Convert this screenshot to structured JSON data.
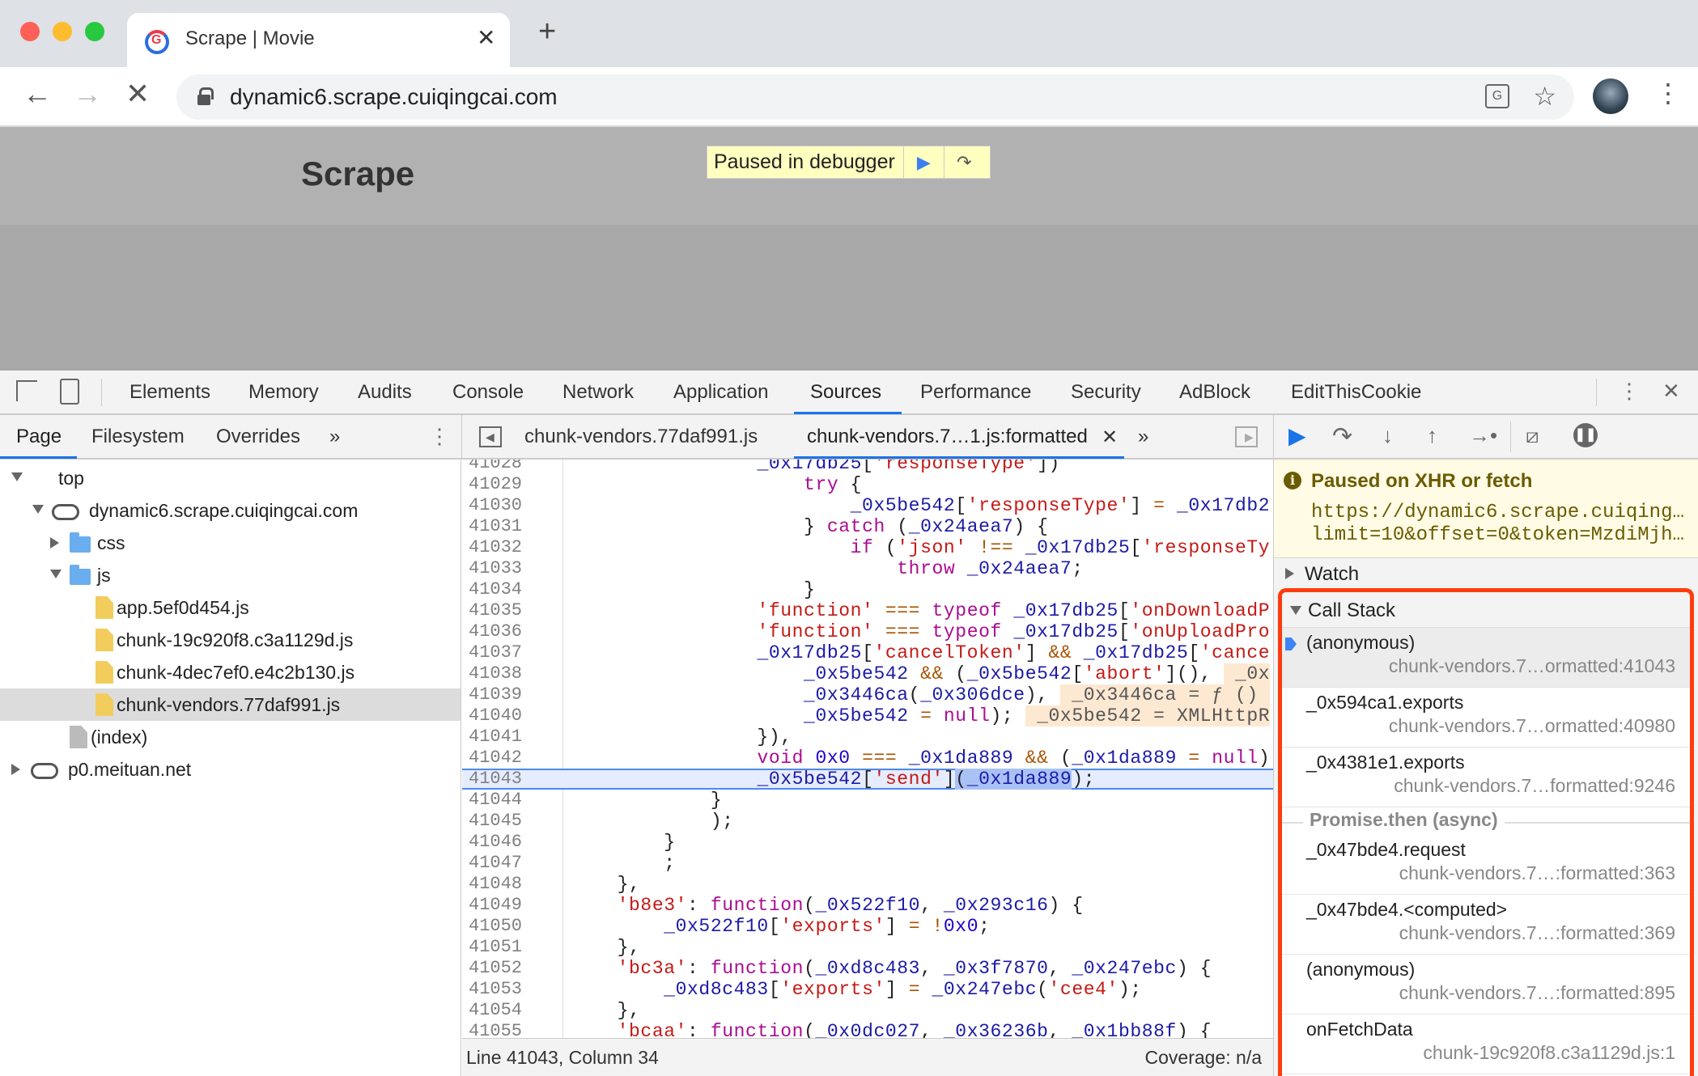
{
  "browser": {
    "tab_title": "Scrape | Movie",
    "url": "dynamic6.scrape.cuiqingcai.com",
    "traffic_colors": {
      "close": "#fe5f57",
      "minimize": "#febc2e",
      "maximize": "#28c840"
    }
  },
  "page": {
    "brand": "Scrape",
    "paused_label": "Paused in debugger"
  },
  "devtools": {
    "tabs": [
      "Elements",
      "Memory",
      "Audits",
      "Console",
      "Network",
      "Application",
      "Sources",
      "Performance",
      "Security",
      "AdBlock",
      "EditThisCookie"
    ],
    "active_tab": "Sources",
    "accent": "#1a73e8",
    "navigator_tabs": [
      "Page",
      "Filesystem",
      "Overrides"
    ],
    "more_label": "»",
    "editor_tabs": [
      {
        "label": "chunk-vendors.77daf991.js",
        "active": false
      },
      {
        "label": "chunk-vendors.7…1.js:formatted",
        "active": true
      }
    ],
    "tree": [
      {
        "label": "top",
        "level": 0,
        "icon": "window",
        "arrow": "down"
      },
      {
        "label": "dynamic6.scrape.cuiqingcai.com",
        "level": 1,
        "icon": "cloud",
        "arrow": "down"
      },
      {
        "label": "css",
        "level": 2,
        "icon": "folder",
        "arrow": "right"
      },
      {
        "label": "js",
        "level": 2,
        "icon": "folder",
        "arrow": "down"
      },
      {
        "label": "app.5ef0d454.js",
        "level": 3,
        "icon": "file"
      },
      {
        "label": "chunk-19c920f8.c3a1129d.js",
        "level": 3,
        "icon": "file"
      },
      {
        "label": "chunk-4dec7ef0.e4c2b130.js",
        "level": 3,
        "icon": "file"
      },
      {
        "label": "chunk-vendors.77daf991.js",
        "level": 3,
        "icon": "file",
        "selected": true
      },
      {
        "label": "(index)",
        "level": 2,
        "icon": "file-gray"
      },
      {
        "label": "p0.meituan.net",
        "level": 0,
        "icon": "cloud",
        "arrow": "right"
      }
    ],
    "code": {
      "current_line": "41043",
      "lines": [
        {
          "n": "41028",
          "t": [
            [
              "p",
              "                "
            ],
            [
              "v",
              "_0x17db25"
            ],
            [
              "p",
              "["
            ],
            [
              "s",
              "'responseType'"
            ],
            [
              "p",
              "])"
            ]
          ]
        },
        {
          "n": "41029",
          "t": [
            [
              "p",
              "                    "
            ],
            [
              "k",
              "try"
            ],
            [
              "p",
              " {"
            ]
          ]
        },
        {
          "n": "41030",
          "t": [
            [
              "p",
              "                        "
            ],
            [
              "v",
              "_0x5be542"
            ],
            [
              "p",
              "["
            ],
            [
              "s",
              "'responseType'"
            ],
            [
              "p",
              "] "
            ],
            [
              "o",
              "="
            ],
            [
              "p",
              " "
            ],
            [
              "v",
              "_0x17db2"
            ]
          ]
        },
        {
          "n": "41031",
          "t": [
            [
              "p",
              "                    } "
            ],
            [
              "k",
              "catch"
            ],
            [
              "p",
              " ("
            ],
            [
              "v",
              "_0x24aea7"
            ],
            [
              "p",
              ") {"
            ]
          ]
        },
        {
          "n": "41032",
          "t": [
            [
              "p",
              "                        "
            ],
            [
              "k",
              "if"
            ],
            [
              "p",
              " ("
            ],
            [
              "s",
              "'json'"
            ],
            [
              "p",
              " "
            ],
            [
              "o",
              "!=="
            ],
            [
              "p",
              " "
            ],
            [
              "v",
              "_0x17db25"
            ],
            [
              "p",
              "["
            ],
            [
              "s",
              "'responseTy"
            ]
          ]
        },
        {
          "n": "41033",
          "t": [
            [
              "p",
              "                            "
            ],
            [
              "k",
              "throw"
            ],
            [
              "p",
              " "
            ],
            [
              "v",
              "_0x24aea7"
            ],
            [
              "p",
              ";"
            ]
          ]
        },
        {
          "n": "41034",
          "t": [
            [
              "p",
              "                    }"
            ]
          ]
        },
        {
          "n": "41035",
          "t": [
            [
              "p",
              "                "
            ],
            [
              "s",
              "'function'"
            ],
            [
              "p",
              " "
            ],
            [
              "o",
              "==="
            ],
            [
              "p",
              " "
            ],
            [
              "k",
              "typeof"
            ],
            [
              "p",
              " "
            ],
            [
              "v",
              "_0x17db25"
            ],
            [
              "p",
              "["
            ],
            [
              "s",
              "'onDownloadP"
            ]
          ]
        },
        {
          "n": "41036",
          "t": [
            [
              "p",
              "                "
            ],
            [
              "s",
              "'function'"
            ],
            [
              "p",
              " "
            ],
            [
              "o",
              "==="
            ],
            [
              "p",
              " "
            ],
            [
              "k",
              "typeof"
            ],
            [
              "p",
              " "
            ],
            [
              "v",
              "_0x17db25"
            ],
            [
              "p",
              "["
            ],
            [
              "s",
              "'onUploadPro"
            ]
          ]
        },
        {
          "n": "41037",
          "t": [
            [
              "p",
              "                "
            ],
            [
              "v",
              "_0x17db25"
            ],
            [
              "p",
              "["
            ],
            [
              "s",
              "'cancelToken'"
            ],
            [
              "p",
              "] "
            ],
            [
              "o",
              "&&"
            ],
            [
              "p",
              " "
            ],
            [
              "v",
              "_0x17db25"
            ],
            [
              "p",
              "["
            ],
            [
              "s",
              "'cance"
            ]
          ]
        },
        {
          "n": "41038",
          "t": [
            [
              "p",
              "                    "
            ],
            [
              "v",
              "_0x5be542"
            ],
            [
              "p",
              " "
            ],
            [
              "o",
              "&&"
            ],
            [
              "p",
              " ("
            ],
            [
              "v",
              "_0x5be542"
            ],
            [
              "p",
              "["
            ],
            [
              "s",
              "'abort'"
            ],
            [
              "p",
              "](), "
            ],
            [
              "iv",
              " _0x"
            ]
          ]
        },
        {
          "n": "41039",
          "t": [
            [
              "p",
              "                    "
            ],
            [
              "v",
              "_0x3446ca"
            ],
            [
              "p",
              "("
            ],
            [
              "v",
              "_0x306dce"
            ],
            [
              "p",
              "), "
            ],
            [
              "iv",
              " _0x3446ca = ƒ () "
            ]
          ]
        },
        {
          "n": "41040",
          "t": [
            [
              "p",
              "                    "
            ],
            [
              "v",
              "_0x5be542"
            ],
            [
              "p",
              " "
            ],
            [
              "o",
              "="
            ],
            [
              "p",
              " "
            ],
            [
              "k",
              "null"
            ],
            [
              "p",
              "); "
            ],
            [
              "iv",
              " _0x5be542 = XMLHttpR"
            ]
          ]
        },
        {
          "n": "41041",
          "t": [
            [
              "p",
              "                }),"
            ]
          ]
        },
        {
          "n": "41042",
          "t": [
            [
              "p",
              "                "
            ],
            [
              "k",
              "void"
            ],
            [
              "p",
              " "
            ],
            [
              "n",
              "0x0"
            ],
            [
              "p",
              " "
            ],
            [
              "o",
              "==="
            ],
            [
              "p",
              " "
            ],
            [
              "v",
              "_0x1da889"
            ],
            [
              "p",
              " "
            ],
            [
              "o",
              "&&"
            ],
            [
              "p",
              " ("
            ],
            [
              "v",
              "_0x1da889"
            ],
            [
              "p",
              " "
            ],
            [
              "o",
              "="
            ],
            [
              "p",
              " "
            ],
            [
              "k",
              "null"
            ],
            [
              "p",
              ")"
            ]
          ]
        },
        {
          "n": "41043",
          "t": [
            [
              "p",
              "                "
            ],
            [
              "v",
              "_0x5be542"
            ],
            [
              "p",
              "["
            ],
            [
              "s",
              "'send'"
            ],
            [
              "p",
              "]"
            ],
            [
              "sel",
              "("
            ],
            [
              "selv",
              "_0x1da889"
            ],
            [
              "p",
              ");"
            ]
          ]
        },
        {
          "n": "41044",
          "t": [
            [
              "p",
              "            }"
            ]
          ]
        },
        {
          "n": "41045",
          "t": [
            [
              "p",
              "            );"
            ]
          ]
        },
        {
          "n": "41046",
          "t": [
            [
              "p",
              "        }"
            ]
          ]
        },
        {
          "n": "41047",
          "t": [
            [
              "p",
              "        ;"
            ]
          ]
        },
        {
          "n": "41048",
          "t": [
            [
              "p",
              "    },"
            ]
          ]
        },
        {
          "n": "41049",
          "t": [
            [
              "p",
              "    "
            ],
            [
              "s",
              "'b8e3'"
            ],
            [
              "p",
              ": "
            ],
            [
              "k",
              "function"
            ],
            [
              "p",
              "("
            ],
            [
              "v",
              "_0x522f10"
            ],
            [
              "p",
              ", "
            ],
            [
              "v",
              "_0x293c16"
            ],
            [
              "p",
              ") {"
            ]
          ]
        },
        {
          "n": "41050",
          "t": [
            [
              "p",
              "        "
            ],
            [
              "v",
              "_0x522f10"
            ],
            [
              "p",
              "["
            ],
            [
              "s",
              "'exports'"
            ],
            [
              "p",
              "] "
            ],
            [
              "o",
              "="
            ],
            [
              "p",
              " "
            ],
            [
              "o",
              "!"
            ],
            [
              "n",
              "0x0"
            ],
            [
              "p",
              ";"
            ]
          ]
        },
        {
          "n": "41051",
          "t": [
            [
              "p",
              "    },"
            ]
          ]
        },
        {
          "n": "41052",
          "t": [
            [
              "p",
              "    "
            ],
            [
              "s",
              "'bc3a'"
            ],
            [
              "p",
              ": "
            ],
            [
              "k",
              "function"
            ],
            [
              "p",
              "("
            ],
            [
              "v",
              "_0xd8c483"
            ],
            [
              "p",
              ", "
            ],
            [
              "v",
              "_0x3f7870"
            ],
            [
              "p",
              ", "
            ],
            [
              "v",
              "_0x247ebc"
            ],
            [
              "p",
              ") {"
            ]
          ]
        },
        {
          "n": "41053",
          "t": [
            [
              "p",
              "        "
            ],
            [
              "v",
              "_0xd8c483"
            ],
            [
              "p",
              "["
            ],
            [
              "s",
              "'exports'"
            ],
            [
              "p",
              "] "
            ],
            [
              "o",
              "="
            ],
            [
              "p",
              " "
            ],
            [
              "v",
              "_0x247ebc"
            ],
            [
              "p",
              "("
            ],
            [
              "s",
              "'cee4'"
            ],
            [
              "p",
              ");"
            ]
          ]
        },
        {
          "n": "41054",
          "t": [
            [
              "p",
              "    },"
            ]
          ]
        },
        {
          "n": "41055",
          "t": [
            [
              "p",
              "    "
            ],
            [
              "s",
              "'bcaa'"
            ],
            [
              "p",
              ": "
            ],
            [
              "k",
              "function"
            ],
            [
              "p",
              "("
            ],
            [
              "v",
              "_0x0dc027"
            ],
            [
              "p",
              ", "
            ],
            [
              "v",
              "_0x36236b"
            ],
            [
              "p",
              ", "
            ],
            [
              "v",
              "_0x1bb88f"
            ],
            [
              "p",
              ") {"
            ]
          ]
        }
      ]
    },
    "status": {
      "position": "Line 41043, Column 34",
      "coverage": "Coverage: n/a"
    },
    "debugger": {
      "pause_title": "Paused on XHR or fetch",
      "pause_url_1": "https://dynamic6.scrape.cuiqing…",
      "pause_url_2": "limit=10&offset=0&token=MzdiMjh…",
      "watch_label": "Watch",
      "call_stack_label": "Call Stack",
      "highlight_color": "#ff3b0f",
      "frames_sync": [
        {
          "fn": "(anonymous)",
          "loc": "chunk-vendors.7…ormatted:41043",
          "current": true
        },
        {
          "fn": "_0x594ca1.exports",
          "loc": "chunk-vendors.7…ormatted:40980"
        },
        {
          "fn": "_0x4381e1.exports",
          "loc": "chunk-vendors.7…formatted:9246"
        }
      ],
      "async_label": "Promise.then (async)",
      "frames_async": [
        {
          "fn": "_0x47bde4.request",
          "loc": "chunk-vendors.7…:formatted:363"
        },
        {
          "fn": "_0x47bde4.<computed>",
          "loc": "chunk-vendors.7…:formatted:369"
        },
        {
          "fn": "(anonymous)",
          "loc": "chunk-vendors.7…:formatted:895"
        },
        {
          "fn": "onFetchData",
          "loc": "chunk-19c920f8.c3a1129d.js:1"
        }
      ]
    }
  }
}
